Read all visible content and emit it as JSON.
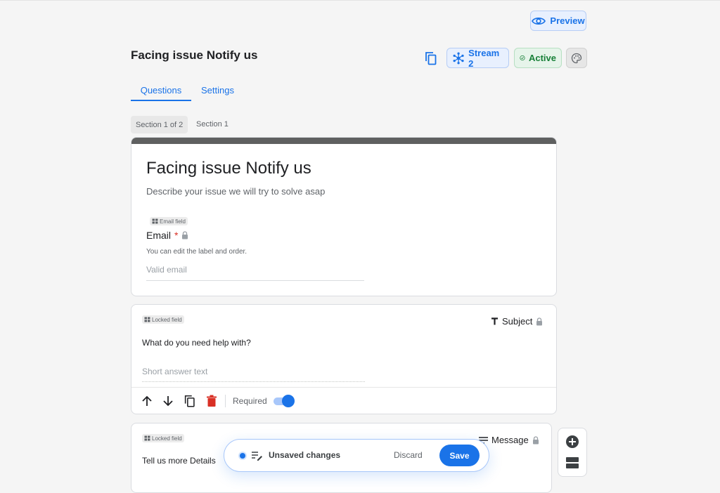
{
  "header": {
    "preview_label": "Preview",
    "page_title": "Facing issue Notify us",
    "stream_label": "Stream 2",
    "status_label": "Active"
  },
  "tabs": [
    {
      "label": "Questions",
      "active": true
    },
    {
      "label": "Settings",
      "active": false
    }
  ],
  "section": {
    "position": "Section 1 of 2",
    "name": "Section 1"
  },
  "form": {
    "title": "Facing issue Notify us",
    "description": "Describe your issue we will try to solve asap",
    "email": {
      "badge": "Email field",
      "label": "Email",
      "required_mark": "*",
      "help": "You can edit the label and order.",
      "placeholder": "Valid email"
    }
  },
  "questions": [
    {
      "badge": "Locked field",
      "type_label": "Subject",
      "type_icon": "text-icon",
      "prompt": "What do you need help with?",
      "placeholder": "Short answer text",
      "required_label": "Required",
      "required": true
    },
    {
      "badge": "Locked field",
      "type_label": "Message",
      "type_icon": "paragraph-icon",
      "prompt": "Tell us more Details"
    }
  ],
  "snackbar": {
    "status": "Unsaved changes",
    "discard_label": "Discard",
    "save_label": "Save"
  },
  "colors": {
    "accent": "#1a73e8",
    "active_green": "#188038",
    "danger": "#d93025",
    "header_band": "#5f6060"
  }
}
